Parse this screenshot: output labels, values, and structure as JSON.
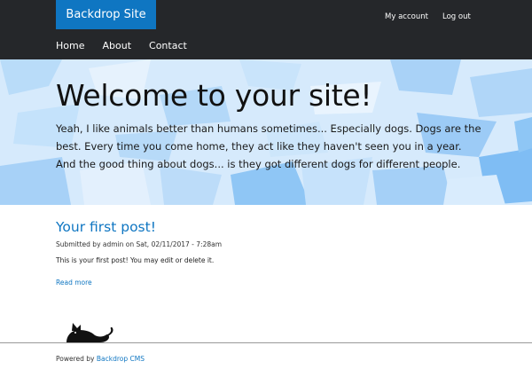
{
  "header": {
    "site_name": "Backdrop Site",
    "account_links": [
      "My account",
      "Log out"
    ],
    "nav": [
      "Home",
      "About",
      "Contact"
    ]
  },
  "hero": {
    "title": "Welcome to your site!",
    "text": "Yeah, I like animals better than humans sometimes... Especially dogs. Dogs are the best. Every time you come home, they act like they haven't seen you in a year. And the good thing about dogs... is they got different dogs for different people."
  },
  "post": {
    "title": "Your first post!",
    "meta": "Submitted by admin on Sat, 02/11/2017 - 7:28am",
    "body": "This is your first post! You may edit or delete it.",
    "read_more": "Read more"
  },
  "footer": {
    "powered_prefix": "Powered by",
    "powered_link": "Backdrop CMS"
  },
  "colors": {
    "topbar": "#25272a",
    "brand": "#0f76c2",
    "link": "#0f76c2",
    "hero_base": "#cfe6fb"
  },
  "icons": {
    "footer_mascot": "cat-icon"
  }
}
